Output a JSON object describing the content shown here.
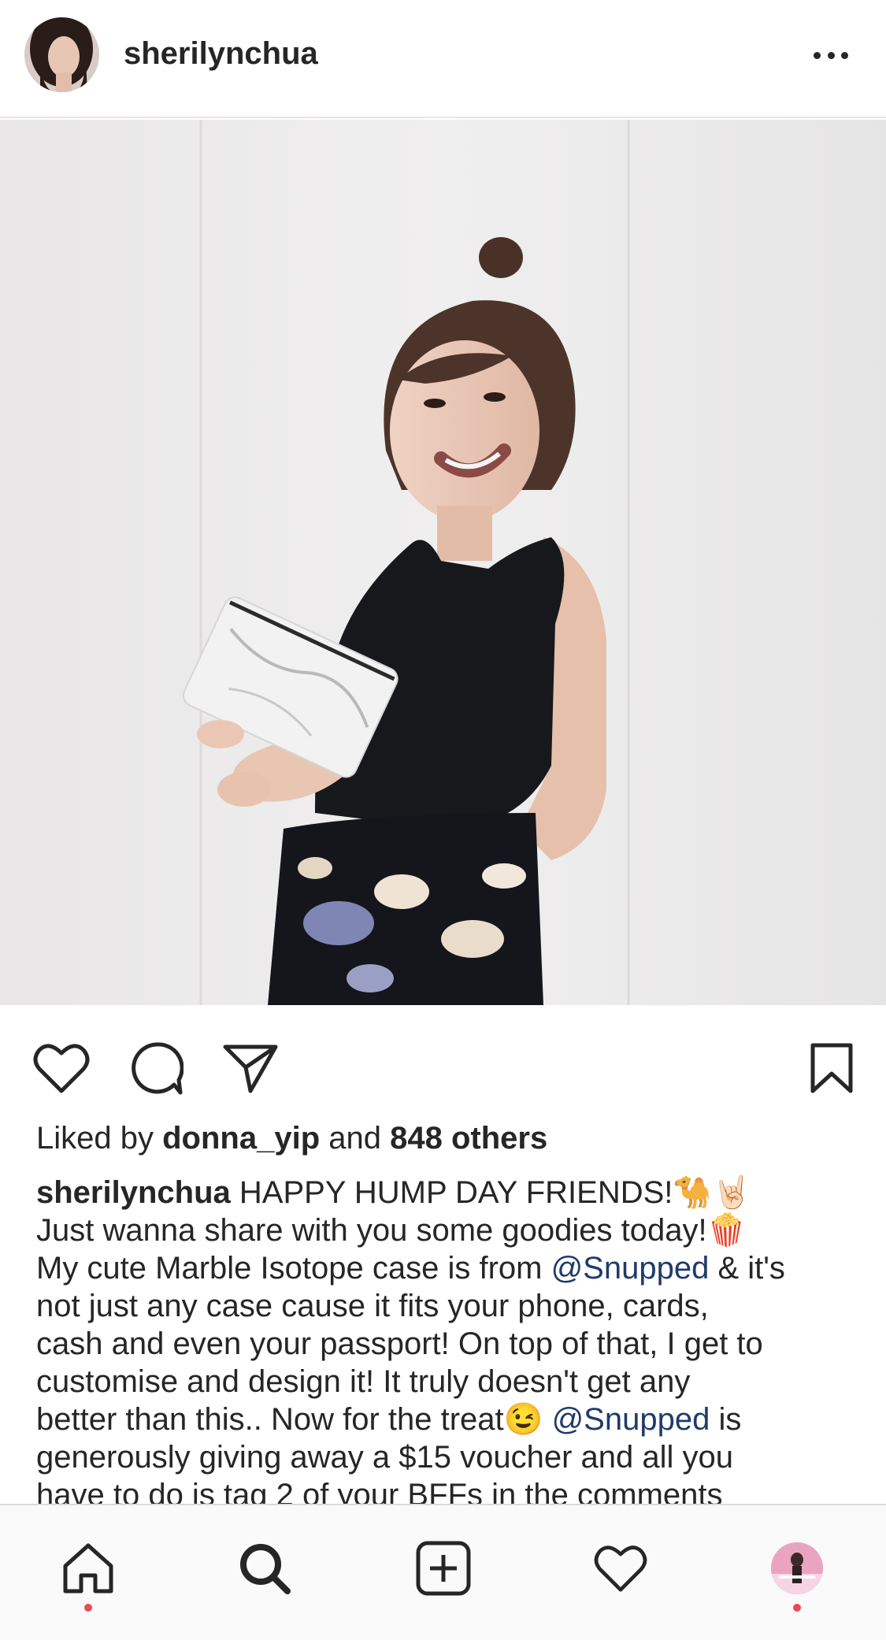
{
  "header": {
    "username": "sherilynchua"
  },
  "post": {
    "likes": {
      "prefix": "Liked by ",
      "user": "donna_yip",
      "middle": " and ",
      "count": "848 others"
    },
    "caption": {
      "username": "sherilynchua",
      "line1": " HAPPY HUMP DAY FRIENDS!🐪🤘🏻",
      "line2": "Just wanna share with you some goodies today!🍿",
      "line3a": "My cute Marble Isotope case is from ",
      "mention1": "@Snupped",
      "line3b": " & it's",
      "line4": "not just any case cause it fits your phone, cards,",
      "line5": "cash and even your passport! On top of that, I get to",
      "line6": "customise and design it! It truly doesn't get any",
      "line7a": "better than this.. Now for the treat😉 ",
      "mention2": "@Snupped",
      "line7b": " is",
      "line8": "generously giving away a $15 voucher and all you",
      "line9": "have to do is tag 2 of your BFFs in the comments"
    }
  },
  "icons": {
    "header_more": "more-options-icon",
    "like": "heart-icon",
    "comment": "comment-icon",
    "share": "paper-plane-icon",
    "save": "bookmark-icon",
    "home": "home-icon",
    "search": "search-icon",
    "new_post": "plus-square-icon",
    "activity": "heart-icon",
    "profile": "profile-avatar"
  },
  "colors": {
    "text": "#262626",
    "mention": "#1f3b6a",
    "notification_dot": "#ed4956",
    "tabbar_bg": "#fafafa"
  }
}
